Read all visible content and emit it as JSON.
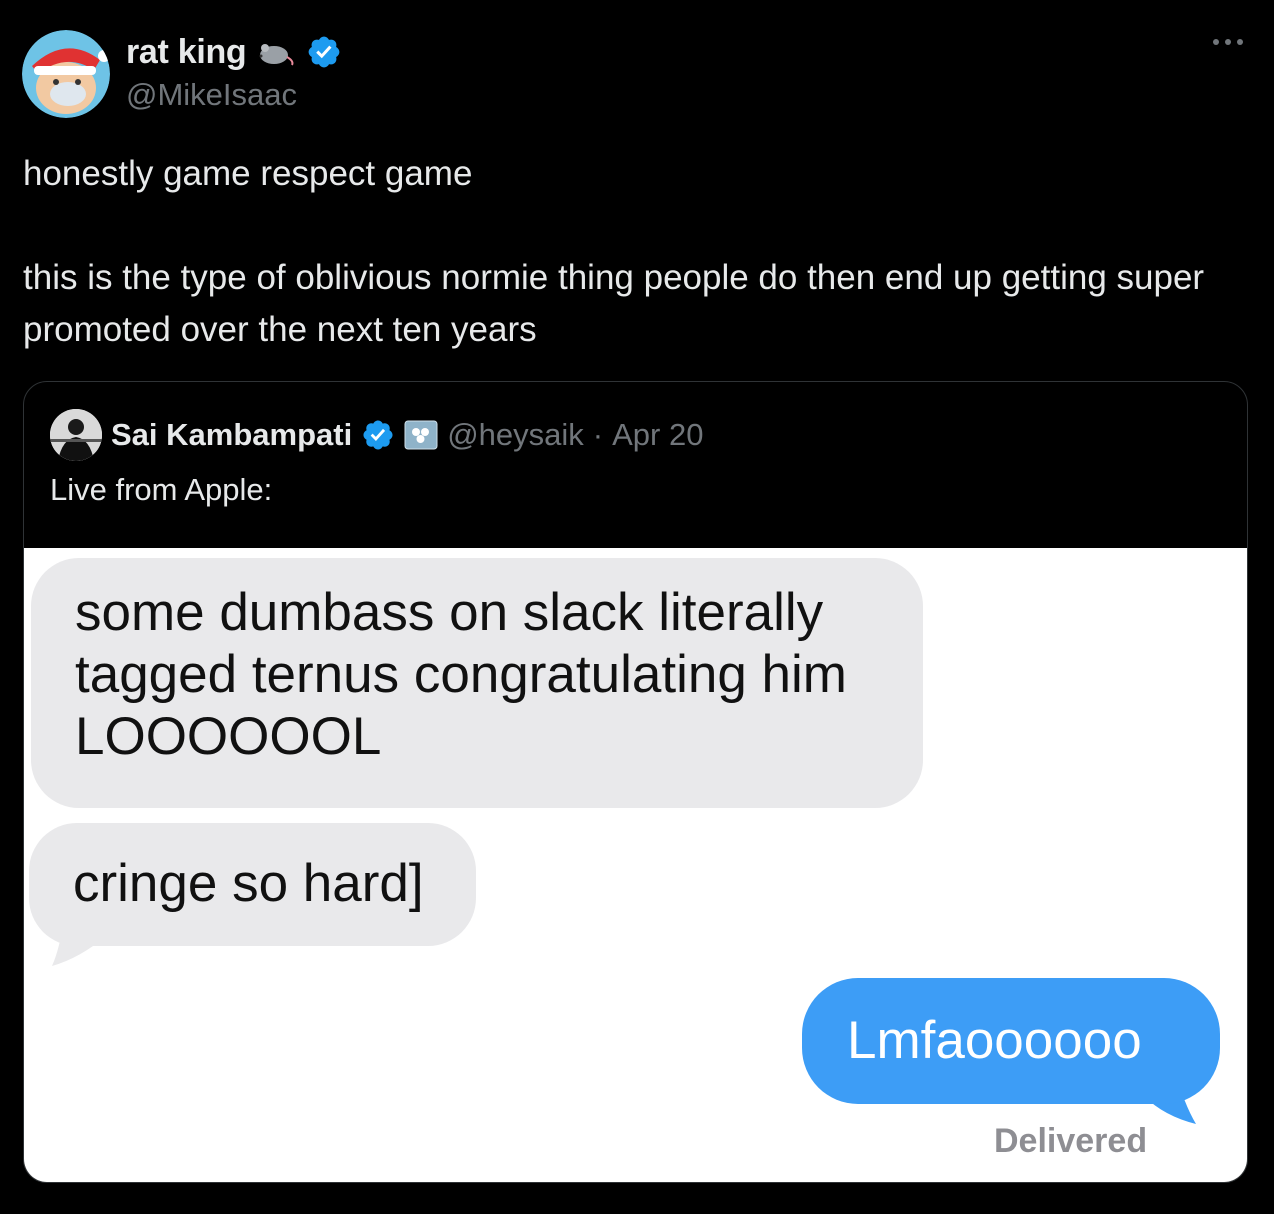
{
  "author": {
    "display_name": "rat king",
    "handle": "@MikeIsaac",
    "verified": true,
    "name_emoji": "mouse-emoji"
  },
  "tweet": {
    "lines": [
      "honestly game respect game",
      "this is the type of oblivious normie thing people do then end up getting super promoted over the next ten years"
    ]
  },
  "quoted": {
    "display_name": "Sai Kambampati",
    "handle": "@heysaik",
    "separator": "·",
    "date": "Apr 20",
    "verified": true,
    "badge_icon": "affiliate-badge-icon",
    "text": "Live from Apple:",
    "messages": {
      "received_1": "some dumbass on slack literally tagged ternus congratulating him LOOOOOOL",
      "received_2": "cringe so hard]",
      "sent": "Lmfaoooooo",
      "status": "Delivered"
    }
  },
  "colors": {
    "background": "#000000",
    "text": "#e7e9ea",
    "muted": "#71767b",
    "verified": "#1d9bf0",
    "imessage_blue": "#3d9df6",
    "imessage_gray": "#e9e9eb"
  },
  "more_icon": "more-horizontal-icon"
}
